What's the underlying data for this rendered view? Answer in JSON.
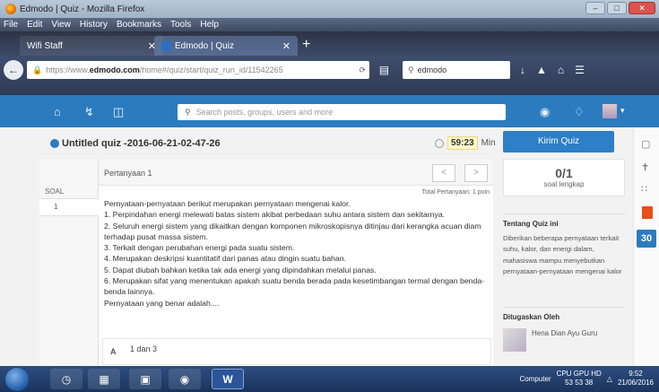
{
  "window": {
    "title": "Edmodo | Quiz - Mozilla Firefox"
  },
  "menu": [
    "File",
    "Edit",
    "View",
    "History",
    "Bookmarks",
    "Tools",
    "Help"
  ],
  "tabs": [
    {
      "label": "Wifi Staff"
    },
    {
      "label": "Edmodo | Quiz"
    }
  ],
  "nav": {
    "url_prefix": "https://www.",
    "url_domain": "edmodo.com",
    "url_path": "/home#/quiz/start/quiz_run_id/11542265",
    "search_value": "edmodo"
  },
  "header": {
    "search_placeholder": "Search posts, groups, users and more"
  },
  "quiz": {
    "title": "Untitled quiz -2016-06-21-02-47-26",
    "timer_value": "59:23",
    "timer_unit": "Min",
    "soal_label": "SOAL",
    "soal_items": [
      "1"
    ],
    "question_title": "Pertanyaan 1",
    "prev": "<",
    "next": ">",
    "total_label": "Total Pertanyaan: 1 poin",
    "question_lines": [
      "Pernyataan-pernyataan berikut merupakan pernyataan mengenai kalor.",
      "1. Perpindahan energi melewati batas sistem akibat perbedaan suhu antara sistem dan sekitarnya.",
      "2. Seluruh energi sistem yang dikaitkan dengan komponen mikroskopisnya ditinjau dari kerangka acuan diam terhadap pusat massa sistem.",
      "3. Terkait dengan perubahan energi pada suatu sistem.",
      "4. Merupakan deskripsi kuantitatif dari panas atau dingin suatu bahan.",
      "5. Dapat diubah bahkan ketika tak ada energi yang dipindahkan melalui panas.",
      "6. Merupakan sifat yang menentukan apakah suatu benda berada pada kesetimbangan termal dengan benda-benda lainnya.",
      "Pernyataan yang benar adalah...."
    ],
    "answer_letter": "A",
    "answer_text": "1 dan 3"
  },
  "right": {
    "submit_label": "Kirim Quiz",
    "score_big": "0/1",
    "score_small": "soal lengkap",
    "about_title": "Tentang Quiz ini",
    "about_text": "Diberikan beberapa pernyataan terkait suhu, kalor, dan energi dalam, mahasiswa mampu menyebutkan pernyataan-pernyataan mengenai kalor",
    "assigned_title": "Ditugaskan Oleh",
    "assigned_name": "Hena Dian Ayu Guru"
  },
  "sidebar_calendar": "30",
  "taskbar": {
    "word_label": "W",
    "computer_label": "Computer",
    "cpu_label": "CPU GPU HD",
    "cpu_values": "53  53  38",
    "time": "9:52",
    "date": "21/06/2016"
  },
  "colors": {
    "edmodo_blue": "#2c7bbf",
    "submit_blue": "#2d7fc7"
  }
}
